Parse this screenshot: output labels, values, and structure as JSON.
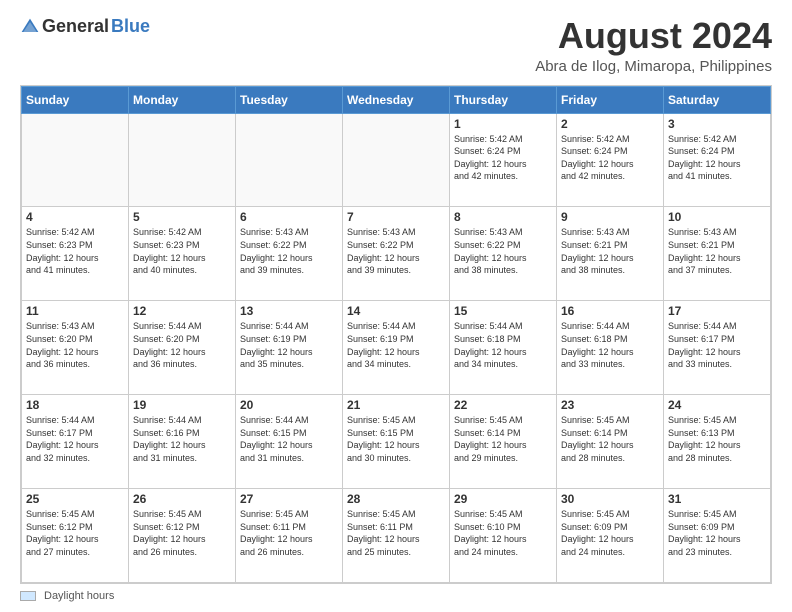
{
  "logo": {
    "general": "General",
    "blue": "Blue"
  },
  "title": "August 2024",
  "subtitle": "Abra de Ilog, Mimaropa, Philippines",
  "days_of_week": [
    "Sunday",
    "Monday",
    "Tuesday",
    "Wednesday",
    "Thursday",
    "Friday",
    "Saturday"
  ],
  "footer": {
    "legend_label": "Daylight hours"
  },
  "weeks": [
    [
      {
        "day": "",
        "info": ""
      },
      {
        "day": "",
        "info": ""
      },
      {
        "day": "",
        "info": ""
      },
      {
        "day": "",
        "info": ""
      },
      {
        "day": "1",
        "info": "Sunrise: 5:42 AM\nSunset: 6:24 PM\nDaylight: 12 hours\nand 42 minutes."
      },
      {
        "day": "2",
        "info": "Sunrise: 5:42 AM\nSunset: 6:24 PM\nDaylight: 12 hours\nand 42 minutes."
      },
      {
        "day": "3",
        "info": "Sunrise: 5:42 AM\nSunset: 6:24 PM\nDaylight: 12 hours\nand 41 minutes."
      }
    ],
    [
      {
        "day": "4",
        "info": "Sunrise: 5:42 AM\nSunset: 6:23 PM\nDaylight: 12 hours\nand 41 minutes."
      },
      {
        "day": "5",
        "info": "Sunrise: 5:42 AM\nSunset: 6:23 PM\nDaylight: 12 hours\nand 40 minutes."
      },
      {
        "day": "6",
        "info": "Sunrise: 5:43 AM\nSunset: 6:22 PM\nDaylight: 12 hours\nand 39 minutes."
      },
      {
        "day": "7",
        "info": "Sunrise: 5:43 AM\nSunset: 6:22 PM\nDaylight: 12 hours\nand 39 minutes."
      },
      {
        "day": "8",
        "info": "Sunrise: 5:43 AM\nSunset: 6:22 PM\nDaylight: 12 hours\nand 38 minutes."
      },
      {
        "day": "9",
        "info": "Sunrise: 5:43 AM\nSunset: 6:21 PM\nDaylight: 12 hours\nand 38 minutes."
      },
      {
        "day": "10",
        "info": "Sunrise: 5:43 AM\nSunset: 6:21 PM\nDaylight: 12 hours\nand 37 minutes."
      }
    ],
    [
      {
        "day": "11",
        "info": "Sunrise: 5:43 AM\nSunset: 6:20 PM\nDaylight: 12 hours\nand 36 minutes."
      },
      {
        "day": "12",
        "info": "Sunrise: 5:44 AM\nSunset: 6:20 PM\nDaylight: 12 hours\nand 36 minutes."
      },
      {
        "day": "13",
        "info": "Sunrise: 5:44 AM\nSunset: 6:19 PM\nDaylight: 12 hours\nand 35 minutes."
      },
      {
        "day": "14",
        "info": "Sunrise: 5:44 AM\nSunset: 6:19 PM\nDaylight: 12 hours\nand 34 minutes."
      },
      {
        "day": "15",
        "info": "Sunrise: 5:44 AM\nSunset: 6:18 PM\nDaylight: 12 hours\nand 34 minutes."
      },
      {
        "day": "16",
        "info": "Sunrise: 5:44 AM\nSunset: 6:18 PM\nDaylight: 12 hours\nand 33 minutes."
      },
      {
        "day": "17",
        "info": "Sunrise: 5:44 AM\nSunset: 6:17 PM\nDaylight: 12 hours\nand 33 minutes."
      }
    ],
    [
      {
        "day": "18",
        "info": "Sunrise: 5:44 AM\nSunset: 6:17 PM\nDaylight: 12 hours\nand 32 minutes."
      },
      {
        "day": "19",
        "info": "Sunrise: 5:44 AM\nSunset: 6:16 PM\nDaylight: 12 hours\nand 31 minutes."
      },
      {
        "day": "20",
        "info": "Sunrise: 5:44 AM\nSunset: 6:15 PM\nDaylight: 12 hours\nand 31 minutes."
      },
      {
        "day": "21",
        "info": "Sunrise: 5:45 AM\nSunset: 6:15 PM\nDaylight: 12 hours\nand 30 minutes."
      },
      {
        "day": "22",
        "info": "Sunrise: 5:45 AM\nSunset: 6:14 PM\nDaylight: 12 hours\nand 29 minutes."
      },
      {
        "day": "23",
        "info": "Sunrise: 5:45 AM\nSunset: 6:14 PM\nDaylight: 12 hours\nand 28 minutes."
      },
      {
        "day": "24",
        "info": "Sunrise: 5:45 AM\nSunset: 6:13 PM\nDaylight: 12 hours\nand 28 minutes."
      }
    ],
    [
      {
        "day": "25",
        "info": "Sunrise: 5:45 AM\nSunset: 6:12 PM\nDaylight: 12 hours\nand 27 minutes."
      },
      {
        "day": "26",
        "info": "Sunrise: 5:45 AM\nSunset: 6:12 PM\nDaylight: 12 hours\nand 26 minutes."
      },
      {
        "day": "27",
        "info": "Sunrise: 5:45 AM\nSunset: 6:11 PM\nDaylight: 12 hours\nand 26 minutes."
      },
      {
        "day": "28",
        "info": "Sunrise: 5:45 AM\nSunset: 6:11 PM\nDaylight: 12 hours\nand 25 minutes."
      },
      {
        "day": "29",
        "info": "Sunrise: 5:45 AM\nSunset: 6:10 PM\nDaylight: 12 hours\nand 24 minutes."
      },
      {
        "day": "30",
        "info": "Sunrise: 5:45 AM\nSunset: 6:09 PM\nDaylight: 12 hours\nand 24 minutes."
      },
      {
        "day": "31",
        "info": "Sunrise: 5:45 AM\nSunset: 6:09 PM\nDaylight: 12 hours\nand 23 minutes."
      }
    ]
  ]
}
